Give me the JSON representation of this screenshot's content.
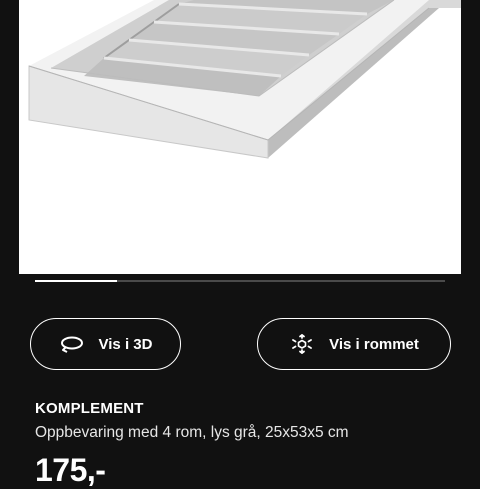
{
  "gallery": {
    "image_alt": "KOMPLEMENT insert with 4 compartments, light grey",
    "progress": 0.2
  },
  "actions": {
    "view_3d": {
      "label": "Vis i 3D",
      "icon": "rotate-3d-icon"
    },
    "view_in_room": {
      "label": "Vis i rommet",
      "icon": "ar-cube-icon"
    }
  },
  "product": {
    "name": "KOMPLEMENT",
    "description": "Oppbevaring med 4 rom, lys grå, 25x53x5 cm",
    "price": "175,-"
  },
  "colors": {
    "background": "#111111",
    "text": "#ffffff",
    "progress_track": "#4a4a4a",
    "progress_fill": "#ffffff"
  }
}
